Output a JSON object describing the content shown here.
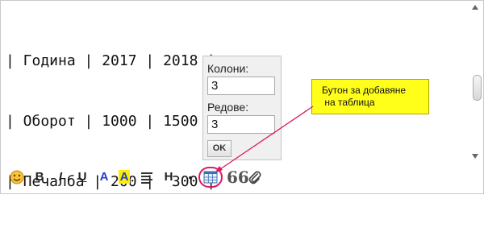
{
  "editor": {
    "lines": [
      "| Година | 2017 | 2018 |",
      "| Оборот | 1000 | 1500 |",
      "| Печалба | 200 |  300 |"
    ]
  },
  "table_popup": {
    "columns_label": "Колони:",
    "columns_value": "3",
    "rows_label": "Редове:",
    "rows_value": "3",
    "ok_label": "OK"
  },
  "callout": {
    "line1": "Бутон за добавяне",
    "line2": " на таблица"
  },
  "toolbar": {
    "bold": "B",
    "italic": "I",
    "underline": "U",
    "text_color": "A",
    "highlight": "A",
    "heading": "H",
    "bullet": "•",
    "quote": "66"
  },
  "colors": {
    "callout_bg": "#ffff1a",
    "annotation": "#d81b62",
    "accent_blue": "#1f3ddb",
    "highlight_yellow": "#ffee00"
  },
  "icons": [
    "emoji-icon",
    "align-icon",
    "table-icon",
    "quote-icon",
    "attachment-icon",
    "scroll-up-icon",
    "scroll-down-icon"
  ]
}
